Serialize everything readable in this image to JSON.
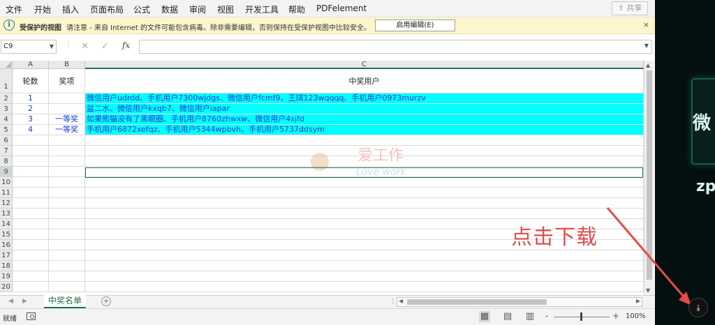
{
  "menubar": {
    "items": [
      "文件",
      "开始",
      "插入",
      "页面布局",
      "公式",
      "数据",
      "审阅",
      "视图",
      "开发工具",
      "帮助",
      "PDFelement"
    ],
    "share_label": "共享"
  },
  "protected_bar": {
    "title": "受保护的视图",
    "message": "请注意 - 来自 Internet 的文件可能包含病毒。除非需要编辑，否则保持在受保护视图中比较安全。",
    "enable_label": "启用编辑(E)",
    "close_glyph": "×"
  },
  "formula_bar": {
    "name_box": "C9",
    "fx": "fx",
    "formula": ""
  },
  "grid": {
    "columns": [
      "A",
      "B",
      "C"
    ],
    "rows": [
      "1",
      "2",
      "3",
      "4",
      "5",
      "6",
      "7",
      "8",
      "9",
      "10",
      "11",
      "12",
      "13",
      "14",
      "15",
      "16",
      "17",
      "18",
      "19",
      "20"
    ],
    "header_row": {
      "a": "轮数",
      "b": "奖项",
      "c": "中奖用户"
    },
    "data_rows": [
      {
        "a": "1",
        "b": "",
        "c": "微信用户udrdd、手机用户7300wjdgs、微信用户fcmf9、王琪123wqqqq、手机用户0973murzv"
      },
      {
        "a": "2",
        "b": "",
        "c": "盆二水、微信用户kxqb7、微信用户iapar"
      },
      {
        "a": "3",
        "b": "一等奖",
        "c": "如果熊猫没有了黑眼圈、手机用户8760zhwxw、微信用户4sjfd"
      },
      {
        "a": "4",
        "b": "一等奖",
        "c": "手机用户6872xefqz、手机用户5344wpbvh、手机用户5737ddsym"
      }
    ],
    "watermark": {
      "line1": "爱工作",
      "line2": "Love work"
    }
  },
  "sheet_tabs": {
    "active": "中奖名单",
    "add_glyph": "+"
  },
  "status_bar": {
    "status": "就绪",
    "zoom_minus": "-",
    "zoom_plus": "+",
    "zoom": "100%"
  },
  "overlay": {
    "hint": "点击下载",
    "dark_char": "微",
    "dark_zp": "zp"
  },
  "colors": {
    "highlight": "#00ffff",
    "cell_text": "#1a3fcf",
    "excel_green": "#217346",
    "hint_red": "#e64b4b"
  }
}
